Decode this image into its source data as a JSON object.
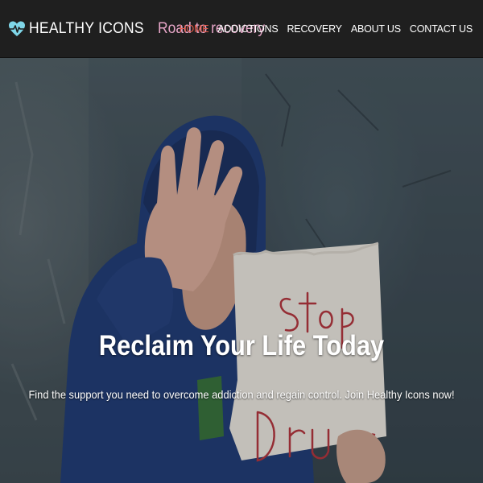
{
  "header": {
    "brand_name": "HEALTHY ICONS",
    "logo_icon": "heart-pulse-icon",
    "tagline": "Road to recovery",
    "nav": [
      {
        "label": "HOME",
        "active": true
      },
      {
        "label": "ADDICTIONS",
        "active": false
      },
      {
        "label": "RECOVERY",
        "active": false
      },
      {
        "label": "ABOUT US",
        "active": false
      },
      {
        "label": "CONTACT US",
        "active": false
      }
    ]
  },
  "hero": {
    "image_sign_text": "Stop Drugs",
    "title": "Reclaim Your Life Today",
    "subtitle": "Find the support you need to overcome addiction and regain control. Join Healthy Icons now!"
  },
  "colors": {
    "header_bg": "#1f1f1f",
    "nav_active": "#e25b4b",
    "tagline": "#e7a6c8",
    "text": "#ffffff",
    "logo_accent": "#7fd6e8"
  }
}
